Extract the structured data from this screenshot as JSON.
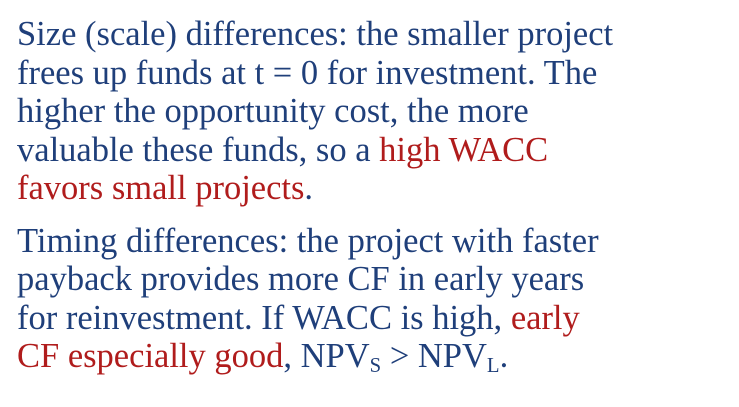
{
  "paragraphs": [
    {
      "lines": [
        {
          "a": "Size (scale) differences:  the smaller project"
        },
        {
          "a": "frees up funds at t = 0 for investment.  The"
        },
        {
          "a": "higher the opportunity cost, the more"
        },
        {
          "a": "valuable these funds, so a ",
          "h": "high WACC"
        },
        {
          "h": "favors small projects",
          "b": "."
        }
      ]
    },
    {
      "lines": [
        {
          "a": "Timing differences:  the project with faster"
        },
        {
          "a": "payback provides more CF in early years"
        },
        {
          "a": "for reinvestment.  If WACC is high, ",
          "h": "early"
        },
        {
          "h": "CF especially good",
          "b": ", NPV",
          "s1": "S",
          "c": " > NPV",
          "s2": "L",
          "d": "."
        }
      ]
    }
  ],
  "colors": {
    "body_text": "#1f3f7a",
    "highlight": "#b01c1c",
    "background": "#ffffff"
  }
}
